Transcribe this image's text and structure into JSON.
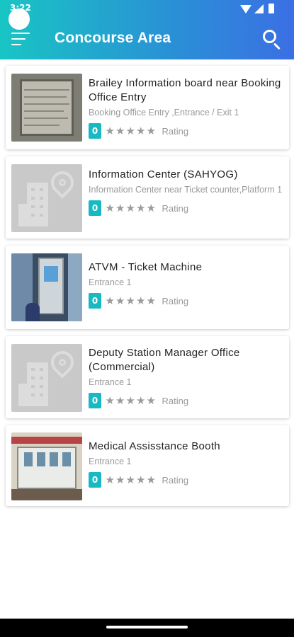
{
  "status_bar": {
    "time": "3:22"
  },
  "header": {
    "title": "Concourse Area",
    "menu_icon": "hamburger-menu-icon",
    "search_icon": "search-icon",
    "gradient_start": "#19c5c4",
    "gradient_end": "#3b6fe4"
  },
  "items": [
    {
      "title": "Brailey Information board near Booking Office Entry",
      "subtitle": "Booking Office Entry ,Entrance / Exit 1",
      "rating_value": "0",
      "rating_label": "Rating",
      "stars_filled": 0,
      "thumbnail": "photo-braille-board"
    },
    {
      "title": "Information Center (SAHYOG)",
      "subtitle": "Information Center near Ticket counter,Platform 1",
      "rating_value": "0",
      "rating_label": "Rating",
      "stars_filled": 0,
      "thumbnail": "placeholder-building-icon"
    },
    {
      "title": "ATVM - Ticket Machine",
      "subtitle": "Entrance 1",
      "rating_value": "0",
      "rating_label": "Rating",
      "stars_filled": 0,
      "thumbnail": "photo-ticket-machine"
    },
    {
      "title": "Deputy Station Manager Office (Commercial)",
      "subtitle": "Entrance 1",
      "rating_value": "0",
      "rating_label": "Rating",
      "stars_filled": 0,
      "thumbnail": "placeholder-building-icon"
    },
    {
      "title": "Medical Assisstance Booth",
      "subtitle": "Entrance 1",
      "rating_value": "0",
      "rating_label": "Rating",
      "stars_filled": 0,
      "thumbnail": "photo-medical-booth"
    }
  ],
  "colors": {
    "badge": "#19b9c3",
    "star_empty": "#9b9b9b"
  }
}
